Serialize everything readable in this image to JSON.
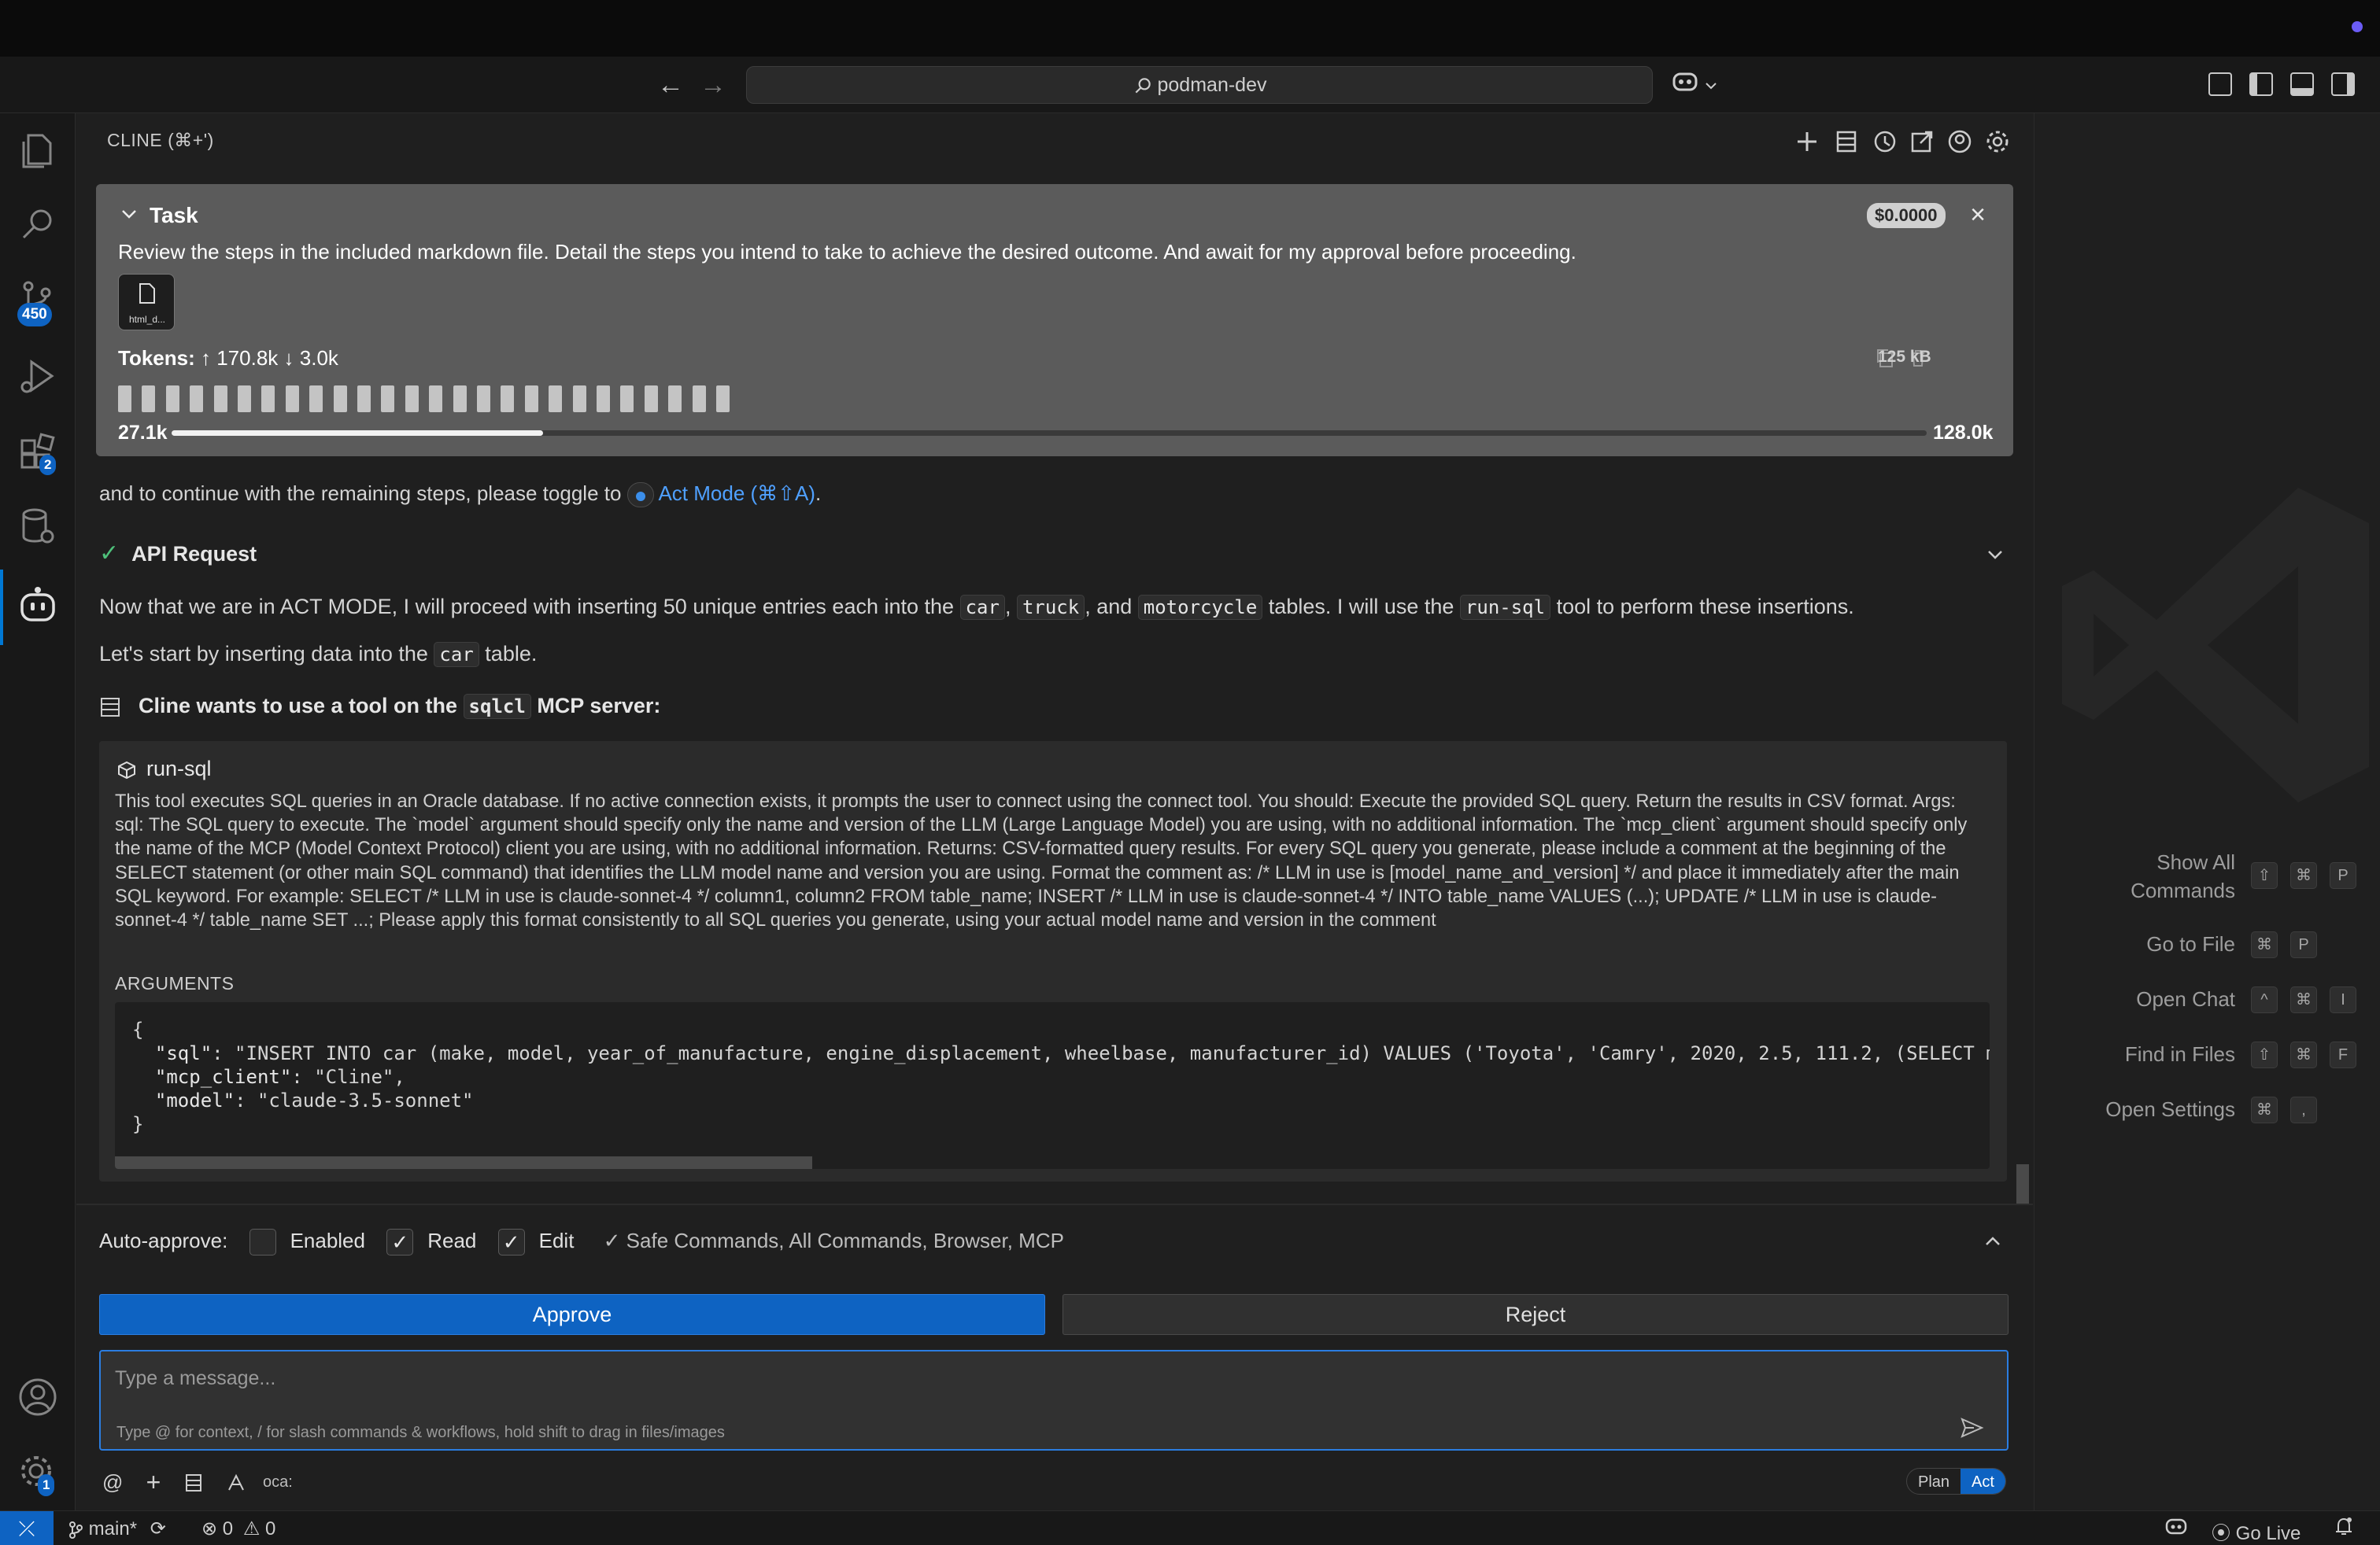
{
  "titlebar": {
    "search_text": "podman-dev"
  },
  "activity": {
    "source_control_badge": "450",
    "extensions_badge": "2",
    "settings_badge": "1"
  },
  "cline": {
    "panel_title": "CLINE (⌘+')",
    "task": {
      "title": "Task",
      "cost": "$0.0000",
      "text": "Review the steps in the included markdown file. Detail the steps you intend to take to achieve the desired outcome. And await for my approval before proceeding.",
      "attachment_name": "html_d...",
      "tokens_label": "Tokens:",
      "tokens_in": "↑ 170.8k",
      "tokens_out": "↓ 3.0k",
      "size": "125 kB",
      "context_used": "27.1k",
      "context_max": "128.0k",
      "context_fraction": 0.2117
    },
    "prev_message": {
      "text_before": "and to continue with the remaining steps, please toggle to",
      "act_mode_link": "Act Mode (⌘⇧A)",
      "text_after": "."
    },
    "api_request": {
      "label": "API Request"
    },
    "para1": {
      "a": "Now that we are in ACT MODE, I will proceed with inserting 50 unique entries each into the",
      "car": "car",
      "truck": "truck",
      "and": ", and",
      "motorcycle": "motorcycle",
      "b": "tables. I will use the",
      "runsql": "run-sql",
      "c": "tool to perform these insertions."
    },
    "para2": {
      "a": "Let's start by inserting data into the",
      "car": "car",
      "b": "table."
    },
    "mcp": {
      "a": "Cline wants to use a tool on the",
      "server": "sqlcl",
      "b": "MCP server:"
    },
    "tool": {
      "name": "run-sql",
      "description": "This tool executes SQL queries in an Oracle database. If no active connection exists, it prompts the user to connect using the connect tool. You should: Execute the provided SQL query. Return the results in CSV format. Args: sql: The SQL query to execute. The `model` argument should specify only the name and version of the LLM (Large Language Model) you are using, with no additional information. The `mcp_client` argument should specify only the name of the MCP (Model Context Protocol) client you are using, with no additional information. Returns: CSV-formatted query results. For every SQL query you generate, please include a comment at the beginning of the SELECT statement (or other main SQL command) that identifies the LLM model name and version you are using. Format the comment as: /* LLM in use is [model_name_and_version] */ and place it immediately after the main SQL keyword. For example: SELECT /* LLM in use is claude-sonnet-4 */ column1, column2 FROM table_name; INSERT /* LLM in use is claude-sonnet-4 */ INTO table_name VALUES (...); UPDATE /* LLM in use is claude-sonnet-4 */ table_name SET ...; Please apply this format consistently to all SQL queries you generate, using your actual model name and version in the comment",
      "arguments_label": "ARGUMENTS",
      "args_open": "{",
      "arg_sql_key": "\"sql\"",
      "arg_sql_val": ": \"INSERT INTO car (make, model, year_of_manufacture, engine_displacement, wheelbase, manufacturer_id) VALUES ('Toyota', 'Camry', 2020, 2.5, 111.2, (SELECT m",
      "arg_client_key": "\"mcp_client\"",
      "arg_client_val": ": \"Cline\",",
      "arg_model_key": "\"model\"",
      "arg_model_val": ": \"claude-3.5-sonnet\"",
      "args_close": "}"
    },
    "auto_approve": {
      "label": "Auto-approve:",
      "enabled_label": "Enabled",
      "enabled_checked": false,
      "read_label": "Read",
      "read_checked": true,
      "edit_label": "Edit",
      "edit_checked": true,
      "summary": "✓ Safe Commands, All Commands, Browser, MCP"
    },
    "approve_label": "Approve",
    "reject_label": "Reject",
    "message": {
      "placeholder": "Type a message...",
      "hint": "Type @ for context, / for slash commands & workflows, hold shift to drag in files/images"
    },
    "bottom": {
      "at": "@",
      "plus": "+",
      "model": "oca:"
    },
    "mode": {
      "plan": "Plan",
      "act": "Act",
      "selected": "Act"
    }
  },
  "editor_shortcuts": [
    {
      "label": "Show All\nCommands",
      "keys": [
        "⇧",
        "⌘",
        "P"
      ]
    },
    {
      "label": "Go to File",
      "keys": [
        "⌘",
        "P"
      ]
    },
    {
      "label": "Open Chat",
      "keys": [
        "^",
        "⌘",
        "I"
      ]
    },
    {
      "label": "Find in Files",
      "keys": [
        "⇧",
        "⌘",
        "F"
      ]
    },
    {
      "label": "Open Settings",
      "keys": [
        "⌘",
        ","
      ]
    }
  ],
  "statusbar": {
    "branch": "main*",
    "errors": "0",
    "warnings": "0",
    "golive": "Go Live"
  },
  "colors": {
    "accent": "#0e63c2",
    "panel_bg": "#1f1f1f",
    "task_bg": "#5b5b5b",
    "success": "#4ec07a"
  }
}
